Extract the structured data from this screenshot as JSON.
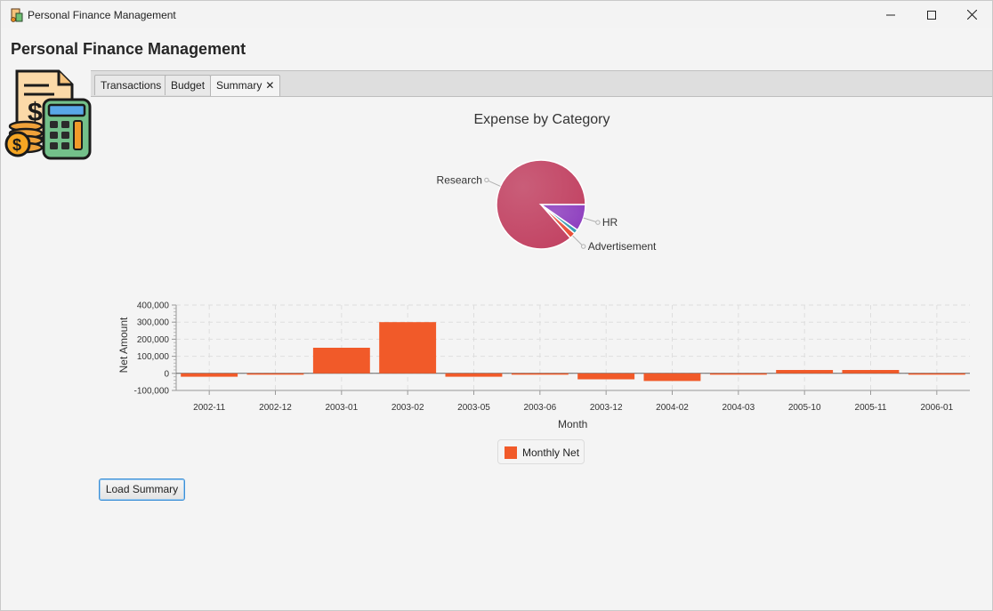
{
  "window": {
    "title": "Personal Finance Management"
  },
  "header": {
    "heading": "Personal Finance Management"
  },
  "tabs": [
    {
      "label": "Transactions",
      "active": false
    },
    {
      "label": "Budget",
      "active": false
    },
    {
      "label": "Summary",
      "active": true,
      "closable": true
    }
  ],
  "icons": {
    "close_tab": "✕",
    "logo": "receipt-calculator-coins-icon"
  },
  "colors": {
    "accent": "#f15a29",
    "research": "#c24363",
    "advertisement": "#e8503a",
    "hr": "#8e3fbf",
    "teal": "#3a9fb5"
  },
  "chart_data": [
    {
      "type": "pie",
      "title": "Expense by Category",
      "slices": [
        {
          "name": "Research",
          "value": 86.5,
          "color": "#c24363"
        },
        {
          "name": "Advertisement",
          "value": 2.2,
          "color": "#e8503a"
        },
        {
          "name": "",
          "value": 1.6,
          "color": "#3a9fb5"
        },
        {
          "name": "HR",
          "value": 9.7,
          "color": "#8e3fbf"
        }
      ]
    },
    {
      "type": "bar",
      "title": "",
      "xlabel": "Month",
      "ylabel": "Net Amount",
      "ylim": [
        -100000,
        400000
      ],
      "yticks": [
        -100000,
        0,
        100000,
        200000,
        300000,
        400000
      ],
      "ytick_labels": [
        "-100,000",
        "0",
        "100,000",
        "200,000",
        "300,000",
        "400,000"
      ],
      "categories": [
        "2002-11",
        "2002-12",
        "2003-01",
        "2003-02",
        "2003-05",
        "2003-06",
        "2003-12",
        "2004-02",
        "2004-03",
        "2005-10",
        "2005-11",
        "2006-01"
      ],
      "series": [
        {
          "name": "Monthly Net",
          "color": "#f15a29",
          "values": [
            -20000,
            -5000,
            150000,
            300000,
            -20000,
            -5000,
            -35000,
            -45000,
            -2000,
            20000,
            20000,
            -2000
          ]
        }
      ],
      "grid": true,
      "legend": "bottom-center"
    }
  ],
  "legend": {
    "label": "Monthly Net"
  },
  "actions": {
    "load_summary": "Load Summary"
  }
}
